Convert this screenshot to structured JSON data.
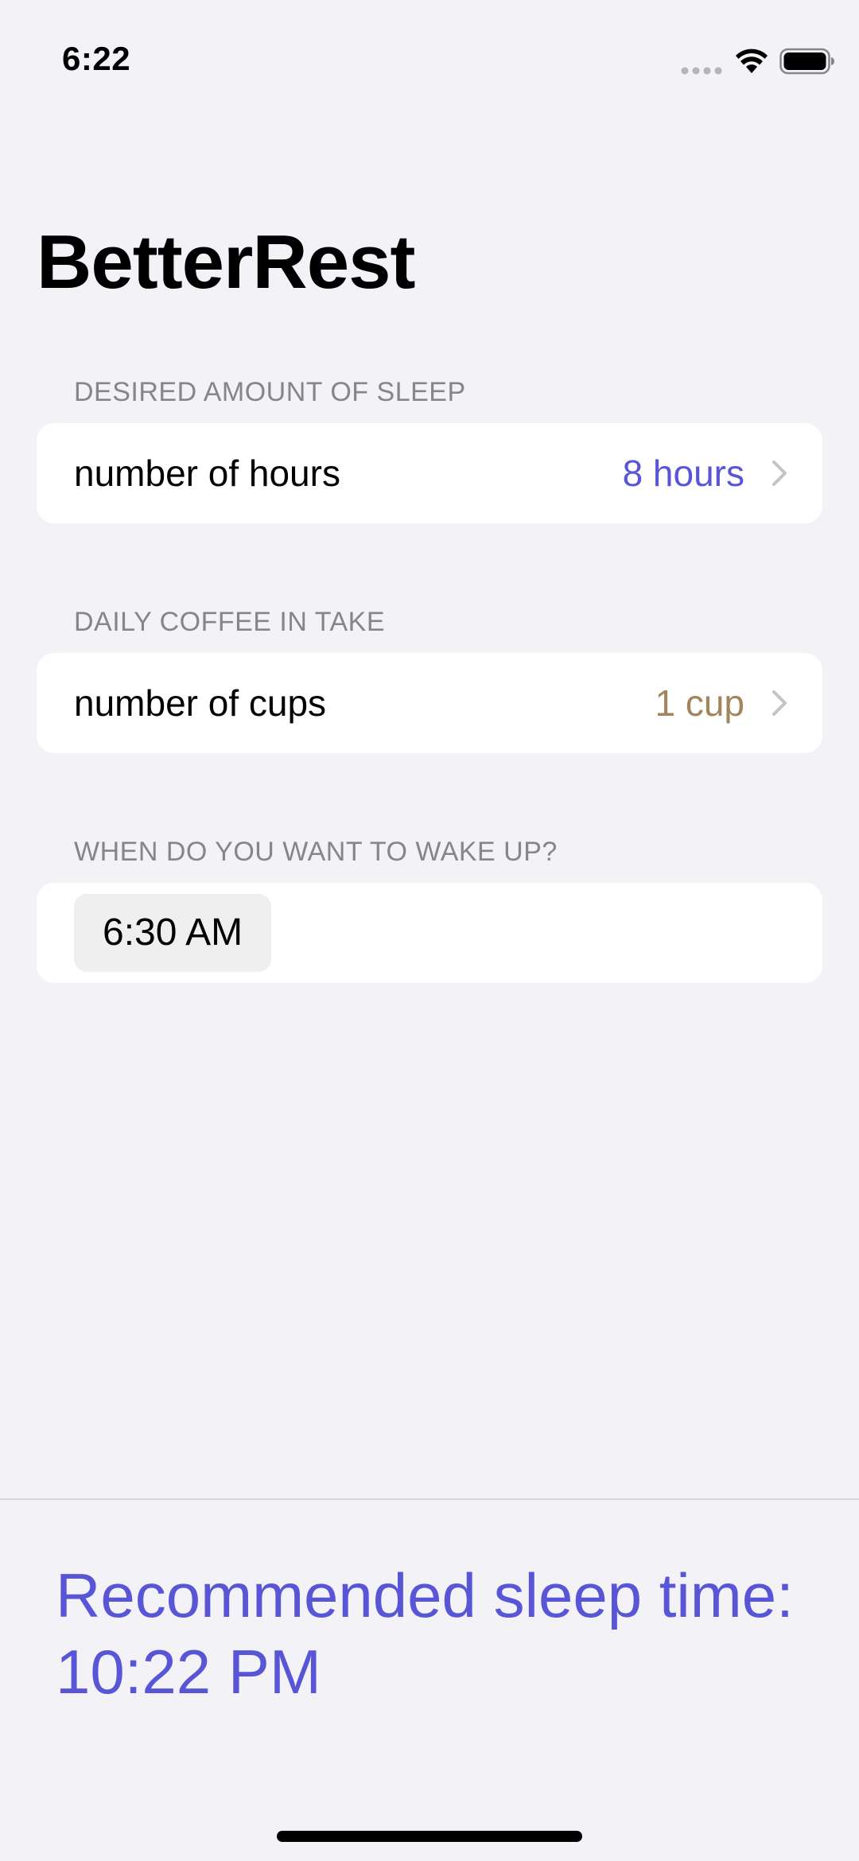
{
  "status_bar": {
    "time": "6:22"
  },
  "app_title": "BetterRest",
  "sections": {
    "sleep": {
      "header": "DESIRED AMOUNT OF SLEEP",
      "label": "number of hours",
      "value": "8 hours"
    },
    "coffee": {
      "header": "DAILY COFFEE IN TAKE",
      "label": "number of cups",
      "value": "1 cup"
    },
    "wake": {
      "header": "WHEN DO YOU WANT TO WAKE UP?",
      "time": "6:30 AM"
    }
  },
  "recommendation": {
    "line1": "Recommended sleep time:",
    "line2": "10:22 PM"
  },
  "colors": {
    "background": "#f2f2f7",
    "accent_purple": "#5856d6",
    "accent_brown": "#a2845e",
    "secondary_text": "#85858b"
  },
  "icons": {
    "signal": "cellular-signal-icon",
    "wifi": "wifi-icon",
    "battery": "battery-icon",
    "chevron": "chevron-right-icon"
  }
}
